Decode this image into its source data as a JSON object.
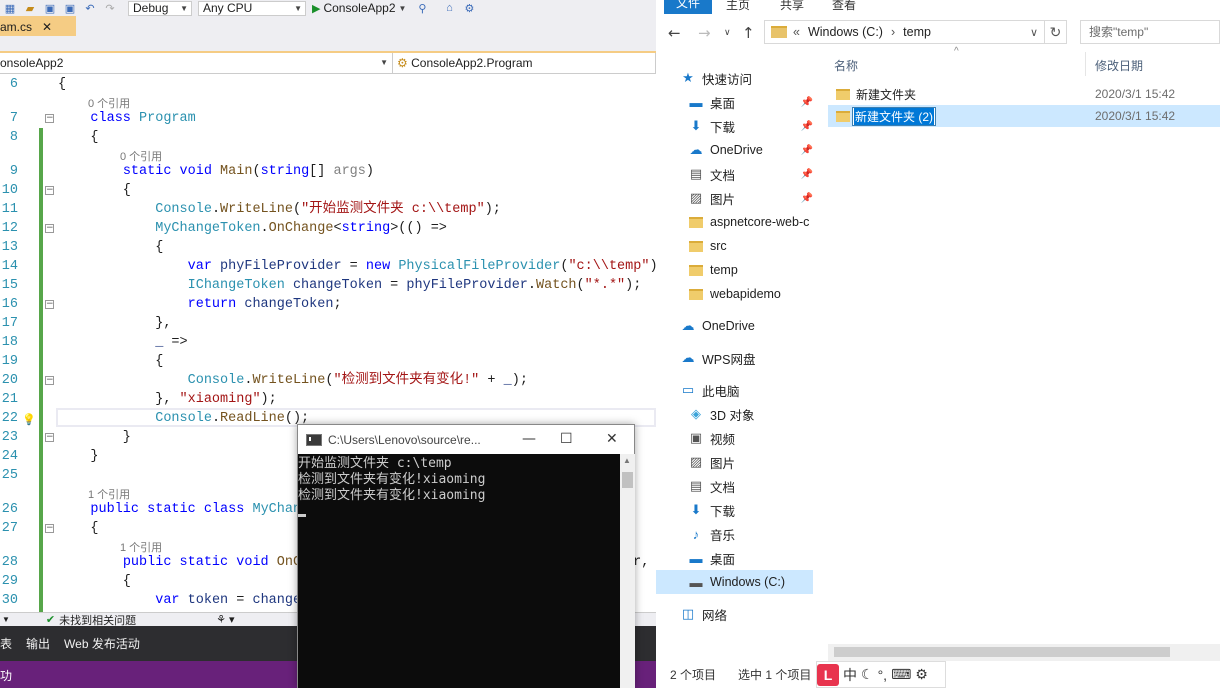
{
  "vs": {
    "toolbar": {
      "config": "Debug",
      "platform": "Any CPU",
      "start_target": "ConsoleApp2"
    },
    "tab": {
      "label": "am.cs",
      "close": "✕"
    },
    "navbar": {
      "project": "onsoleApp2",
      "type": "ConsoleApp2.Program"
    },
    "code_lines": [
      {
        "n": "6",
        "html": "<span>{</span>"
      },
      {
        "n": "7",
        "html": "    <span class=\"k\">class</span> <span class=\"t\">Program</span>"
      },
      {
        "n": "8",
        "html": "    {"
      },
      {
        "n": "9",
        "html": "        <span class=\"k\">static</span> <span class=\"k\">void</span> <span class=\"m\">Main</span>(<span class=\"k\">string</span>[] <span class=\"u\">args</span>)"
      },
      {
        "n": "10",
        "html": "        {"
      },
      {
        "n": "11",
        "html": "            <span class=\"t\">Console</span>.<span class=\"m\">WriteLine</span>(<span class=\"s\">\"开始监测文件夹 c:\\\\temp\"</span>);"
      },
      {
        "n": "12",
        "html": "            <span class=\"t\">MyChangeToken</span>.<span class=\"m\">OnChange</span>&lt;<span class=\"k\">string</span>&gt;(() =&gt;"
      },
      {
        "n": "13",
        "html": "            {"
      },
      {
        "n": "14",
        "html": "                <span class=\"k\">var</span> <span class=\"p\">phyFileProvider</span> = <span class=\"k\">new</span> <span class=\"t\">PhysicalFileProvider</span>(<span class=\"s\">\"c:\\\\temp\"</span>);"
      },
      {
        "n": "15",
        "html": "                <span class=\"t\">IChangeToken</span> <span class=\"p\">changeToken</span> = <span class=\"p\">phyFileProvider</span>.<span class=\"m\">Watch</span>(<span class=\"s\">\"*.*\"</span>);"
      },
      {
        "n": "16",
        "html": "                <span class=\"k\">return</span> <span class=\"p\">changeToken</span>;"
      },
      {
        "n": "17",
        "html": "            },"
      },
      {
        "n": "18",
        "html": "            <span class=\"p\">_</span> =&gt;"
      },
      {
        "n": "19",
        "html": "            {"
      },
      {
        "n": "20",
        "html": "                <span class=\"t\">Console</span>.<span class=\"m\">WriteLine</span>(<span class=\"s\">\"检测到文件夹有变化!\"</span> + <span class=\"p\">_</span>);"
      },
      {
        "n": "21",
        "html": "            }, <span class=\"s\">\"xiaoming\"</span>);"
      },
      {
        "n": "22",
        "html": "            <span class=\"t\">Console</span>.<span class=\"m\">ReadLine</span>();"
      },
      {
        "n": "23",
        "html": "        }"
      },
      {
        "n": "24",
        "html": "    }"
      },
      {
        "n": "25",
        "html": ""
      },
      {
        "n": "26",
        "html": "    <span class=\"k\">public</span> <span class=\"k\">static</span> <span class=\"k\">class</span> <span class=\"t\">MyChan</span>"
      },
      {
        "n": "27",
        "html": "    {"
      },
      {
        "n": "28",
        "html": "        <span class=\"k\">public</span> <span class=\"k\">static</span> <span class=\"k\">void</span> <span class=\"m\">OnC</span>"
      },
      {
        "n": "29",
        "html": "        {"
      },
      {
        "n": "30",
        "html": "            <span class=\"k\">var</span> <span class=\"p\">token</span> = <span class=\"p\">change</span>"
      }
    ],
    "refs": [
      "0 个引用",
      "0 个引用",
      "1 个引用",
      "1 个引用"
    ],
    "code_tail_28": "er,",
    "status_issue": "未找到相关问题",
    "bottom_tabs": [
      "表",
      "输出",
      "Web 发布活动"
    ],
    "bottom_left": "功"
  },
  "console": {
    "title": "C:\\Users\\Lenovo\\source\\re...",
    "lines": [
      "开始监测文件夹 c:\\temp",
      "检测到文件夹有变化!xiaoming",
      "检测到文件夹有变化!xiaoming"
    ]
  },
  "explorer": {
    "ribbon": {
      "file": "文件",
      "home": "主页",
      "share": "共享",
      "view": "查看"
    },
    "address": {
      "prefix": "«",
      "drive": "Windows (C:)",
      "sep": "›",
      "folder": "temp"
    },
    "search_placeholder": "搜索\"temp\"",
    "columns": {
      "name": "名称",
      "date": "修改日期"
    },
    "nav": [
      {
        "label": "快速访问",
        "icon": "star-icon"
      },
      {
        "label": "桌面",
        "icon": "desktop-icon",
        "pin": true
      },
      {
        "label": "下载",
        "icon": "download-icon",
        "pin": true
      },
      {
        "label": "OneDrive",
        "icon": "cloud-icon",
        "pin": true
      },
      {
        "label": "文档",
        "icon": "document-icon",
        "pin": true
      },
      {
        "label": "图片",
        "icon": "picture-icon",
        "pin": true
      },
      {
        "label": "aspnetcore-web-c",
        "icon": "folder-icon"
      },
      {
        "label": "src",
        "icon": "folder-icon"
      },
      {
        "label": "temp",
        "icon": "folder-icon"
      },
      {
        "label": "webapidemo",
        "icon": "folder-icon"
      },
      {
        "label": "OneDrive",
        "icon": "cloud-icon"
      },
      {
        "label": "WPS网盘",
        "icon": "cloud-outline-icon"
      },
      {
        "label": "此电脑",
        "icon": "computer-icon"
      },
      {
        "label": "3D 对象",
        "icon": "cube-icon"
      },
      {
        "label": "视频",
        "icon": "video-icon"
      },
      {
        "label": "图片",
        "icon": "picture-icon"
      },
      {
        "label": "文档",
        "icon": "document-icon"
      },
      {
        "label": "下载",
        "icon": "download-icon"
      },
      {
        "label": "音乐",
        "icon": "music-icon"
      },
      {
        "label": "桌面",
        "icon": "desktop-icon"
      },
      {
        "label": "Windows (C:)",
        "icon": "drive-icon"
      },
      {
        "label": "网络",
        "icon": "network-icon"
      }
    ],
    "files": [
      {
        "name": "新建文件夹",
        "date": "2020/3/1 15:42"
      },
      {
        "name": "新建文件夹 (2)",
        "date": "2020/3/1 15:42"
      }
    ],
    "status": {
      "count": "2 个项目",
      "selected": "选中 1 个项目"
    },
    "ime": {
      "logo": "L",
      "lang": "中"
    }
  }
}
